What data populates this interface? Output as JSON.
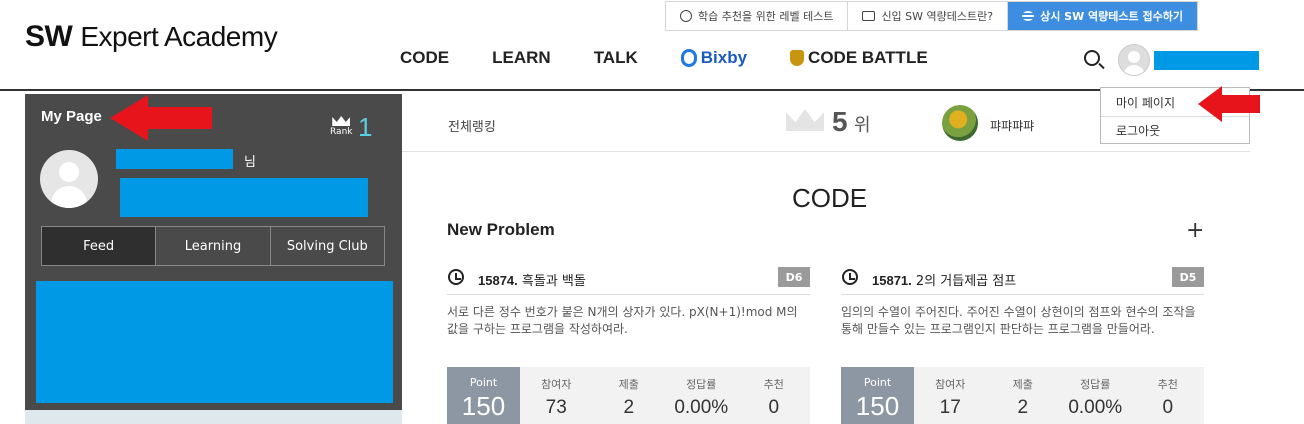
{
  "header": {
    "logo_bold": "SW",
    "logo_text": "Expert Academy",
    "top_links": [
      {
        "label": "학습 추천을 위한 레벨 테스트",
        "icon": "check-circle-icon"
      },
      {
        "label": "신입 SW 역량테스트란?",
        "icon": "monitor-icon"
      },
      {
        "label": "상시 SW 역량테스트 접수하기",
        "icon": "list-icon"
      }
    ],
    "nav": {
      "code": "CODE",
      "learn": "LEARN",
      "talk": "TALK",
      "bixby": "Bixby",
      "code_battle": "CODE BATTLE"
    }
  },
  "dropdown": {
    "items": [
      "마이 페이지",
      "로그아웃"
    ]
  },
  "left_panel": {
    "title": "My Page",
    "rank_label": "Rank",
    "rank_value": "1",
    "honorific": "님",
    "tabs": [
      "Feed",
      "Learning",
      "Solving Club"
    ]
  },
  "ranking": {
    "label": "전체랭킹",
    "position": "5",
    "suffix": "위",
    "user_name": "퍄퍄퍄퍄"
  },
  "main": {
    "section_title": "CODE",
    "new_problem_title": "New Problem",
    "add_label": "+"
  },
  "problems": [
    {
      "id": "15874.",
      "title": "흑돌과 백돌",
      "level": "D6",
      "description": "서로 다른 정수 번호가 붙은 N개의 상자가 있다. pX(N+1)!mod M의 값을 구하는 프로그램을 작성하여라.",
      "point_label": "Point",
      "point": "150",
      "stats": [
        {
          "label": "참여자",
          "value": "73"
        },
        {
          "label": "제출",
          "value": "2"
        },
        {
          "label": "정답률",
          "value": "0.00%"
        },
        {
          "label": "추천",
          "value": "0"
        }
      ]
    },
    {
      "id": "15871.",
      "title": "2의 거듭제곱 점프",
      "level": "D5",
      "description": "임의의 수열이 주어진다. 주어진 수열이 상현이의 점프와 현수의 조작을 통해 만들수 있는 프로그램인지 판단하는 프로그램을 만들어라.",
      "point_label": "Point",
      "point": "150",
      "stats": [
        {
          "label": "참여자",
          "value": "17"
        },
        {
          "label": "제출",
          "value": "2"
        },
        {
          "label": "정답률",
          "value": "0.00%"
        },
        {
          "label": "추천",
          "value": "0"
        }
      ]
    }
  ],
  "colors": {
    "redaction": "#0099e5",
    "accent": "#3d8ee0",
    "annotation_arrow": "#e8141c"
  }
}
